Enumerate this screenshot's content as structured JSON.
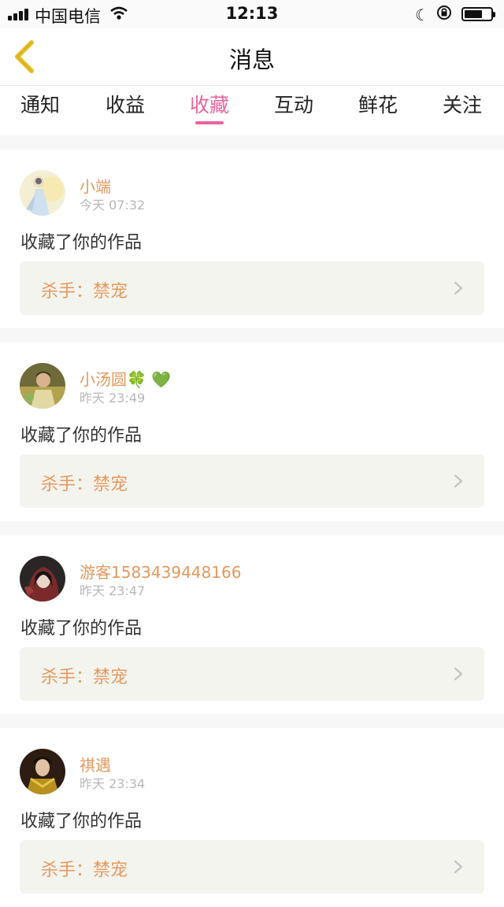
{
  "status_bar": {
    "carrier": "中国电信",
    "time": "12:13"
  },
  "nav": {
    "title": "消息"
  },
  "tabs": [
    {
      "label": "通知",
      "active": false
    },
    {
      "label": "收益",
      "active": false
    },
    {
      "label": "收藏",
      "active": true
    },
    {
      "label": "互动",
      "active": false
    },
    {
      "label": "鲜花",
      "active": false
    },
    {
      "label": "关注",
      "active": false
    }
  ],
  "messages": [
    {
      "username": "小端",
      "time": "今天 07:32",
      "action": "收藏了你的作品",
      "work_title": "杀手：禁宠"
    },
    {
      "username": "小汤圆🍀 💚",
      "time": "昨天 23:49",
      "action": "收藏了你的作品",
      "work_title": "杀手：禁宠"
    },
    {
      "username": "游客1583439448166",
      "time": "昨天 23:47",
      "action": "收藏了你的作品",
      "work_title": "杀手：禁宠"
    },
    {
      "username": "祺遇",
      "time": "昨天 23:34",
      "action": "收藏了你的作品",
      "work_title": "杀手：禁宠"
    }
  ],
  "colors": {
    "accent": "#e8659e",
    "username": "#e5985d",
    "back_arrow": "#e6c12a"
  }
}
